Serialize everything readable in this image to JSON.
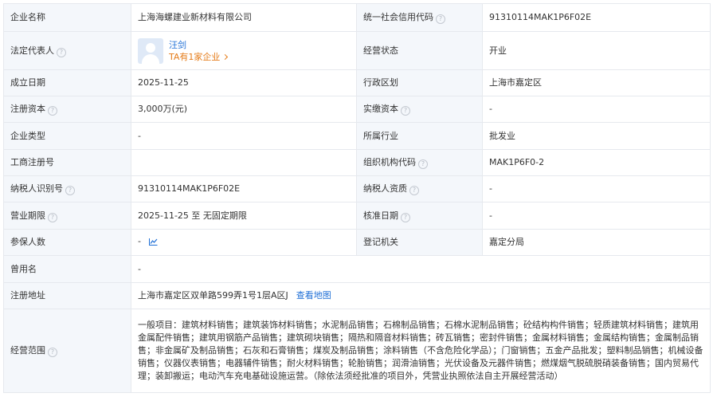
{
  "rows": {
    "company_name": {
      "label": "企业名称",
      "value": "上海海螺建业新材料有限公司"
    },
    "credit_code": {
      "label": "统一社会信用代码",
      "value": "91310114MAK1P6F02E"
    },
    "legal_rep": {
      "label": "法定代表人",
      "name": "汪剑",
      "companies": "TA有1家企业"
    },
    "status": {
      "label": "经营状态",
      "value": "开业"
    },
    "established": {
      "label": "成立日期",
      "value": "2025-11-25"
    },
    "district": {
      "label": "行政区划",
      "value": "上海市嘉定区"
    },
    "capital": {
      "label": "注册资本",
      "value": "3,000万(元)"
    },
    "paid_capital": {
      "label": "实缴资本",
      "value": "-"
    },
    "company_type": {
      "label": "企业类型",
      "value": "-"
    },
    "industry": {
      "label": "所属行业",
      "value": "批发业"
    },
    "reg_no": {
      "label": "工商注册号",
      "value": ""
    },
    "org_code": {
      "label": "组织机构代码",
      "value": "MAK1P6F0-2"
    },
    "taxpayer_id": {
      "label": "纳税人识别号",
      "value": "91310114MAK1P6F02E"
    },
    "taxpayer_qual": {
      "label": "纳税人资质",
      "value": "-"
    },
    "term": {
      "label": "营业期限",
      "value": "2025-11-25 至 无固定期限"
    },
    "approval_date": {
      "label": "核准日期",
      "value": "-"
    },
    "insured": {
      "label": "参保人数",
      "value": "-"
    },
    "authority": {
      "label": "登记机关",
      "value": "嘉定分局"
    },
    "former_name": {
      "label": "曾用名",
      "value": "-"
    },
    "address": {
      "label": "注册地址",
      "value": "上海市嘉定区双单路599弄1号1层A区J",
      "map_link": "查看地图"
    },
    "scope": {
      "label": "经营范围",
      "value": "一般项目：建筑材料销售；建筑装饰材料销售；水泥制品销售；石棉制品销售；石棉水泥制品销售；砼结构构件销售；轻质建筑材料销售；建筑用金属配件销售；建筑用钢筋产品销售；建筑砌块销售；隔热和隔音材料销售；砖瓦销售；密封件销售；金属材料销售；金属结构销售；金属制品销售；非金属矿及制品销售；石灰和石膏销售；煤炭及制品销售；涂料销售（不含危险化学品）；门窗销售；五金产品批发；塑料制品销售；机械设备销售；仪器仪表销售；电器辅件销售；耐火材料销售；轮胎销售；润滑油销售；光伏设备及元器件销售；燃煤烟气脱硫脱硝装备销售；国内贸易代理；装卸搬运；电动汽车充电基础设施运营。（除依法须经批准的项目外，凭营业执照依法自主开展经营活动）"
    }
  },
  "icons": {
    "help": "question-circle-icon",
    "trend": "trend-chart-icon",
    "avatar": "user-avatar-icon",
    "chevron": "chevron-right-icon"
  },
  "colors": {
    "label_bg": "#f4f7fb",
    "border": "#e6e9ee",
    "link": "#1f6fd6",
    "accent": "#e57c1a"
  }
}
